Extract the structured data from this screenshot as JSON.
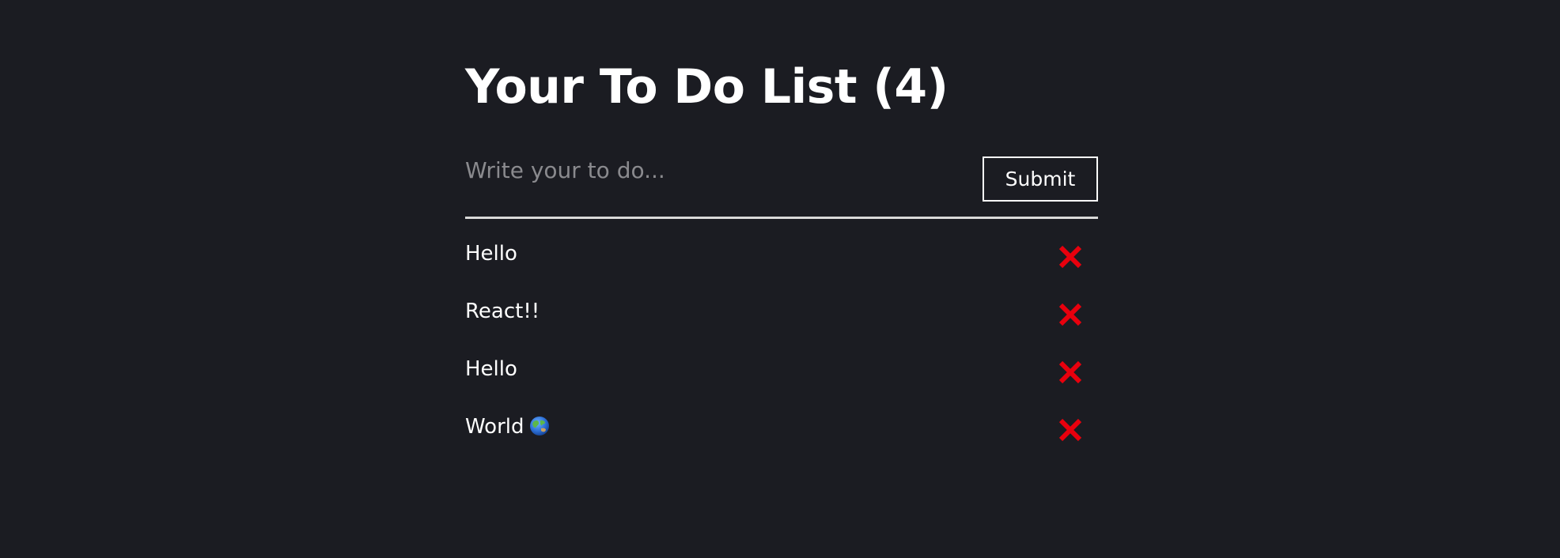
{
  "header": {
    "title": "Your To Do List (4)"
  },
  "form": {
    "input_placeholder": "Write your to do...",
    "input_value": "",
    "submit_label": "Submit"
  },
  "todos": [
    {
      "text": "Hello",
      "emoji_icon": null
    },
    {
      "text": "React!!",
      "emoji_icon": null
    },
    {
      "text": "Hello",
      "emoji_icon": null
    },
    {
      "text": "World",
      "emoji_icon": "globe-asia-australia-icon"
    }
  ],
  "icons": {
    "delete": "close-icon"
  },
  "colors": {
    "background": "#1b1c22",
    "text": "#ffffff",
    "placeholder": "#8a8a8e",
    "delete": "#e8000d",
    "divider": "#d9d9d9"
  }
}
